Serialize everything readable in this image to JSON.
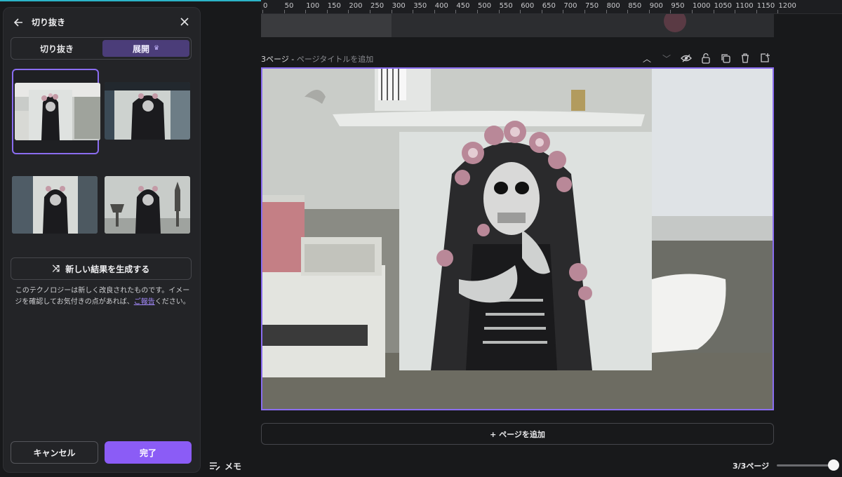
{
  "panel": {
    "title": "切り抜き",
    "tabs": [
      {
        "label": "切り抜き"
      },
      {
        "label": "展開",
        "badge_icon": "crown-icon"
      }
    ],
    "generate_label": "新しい結果を生成する",
    "note_text": "このテクノロジーは新しく改良されたものです。イメージを確認してお気付きの点があれば、",
    "note_link": "ご報告",
    "note_tail": "ください。",
    "cancel_label": "キャンセル",
    "done_label": "完了"
  },
  "ruler": {
    "ticks": [
      "0",
      "50",
      "100",
      "150",
      "200",
      "250",
      "300",
      "350",
      "400",
      "450",
      "500",
      "550",
      "600",
      "650",
      "700",
      "750",
      "800",
      "850",
      "900",
      "950",
      "1000",
      "1050",
      "1100",
      "1150",
      "1200"
    ]
  },
  "page": {
    "label_number": "3ページ - ",
    "label_placeholder": "ページタイトルを追加",
    "add_page_label": "+ ページを追加"
  },
  "footer": {
    "memo_label": "メモ",
    "page_count": "3/3ページ"
  },
  "colors": {
    "accent": "#8b5cf6",
    "selection": "#8a6df0"
  }
}
